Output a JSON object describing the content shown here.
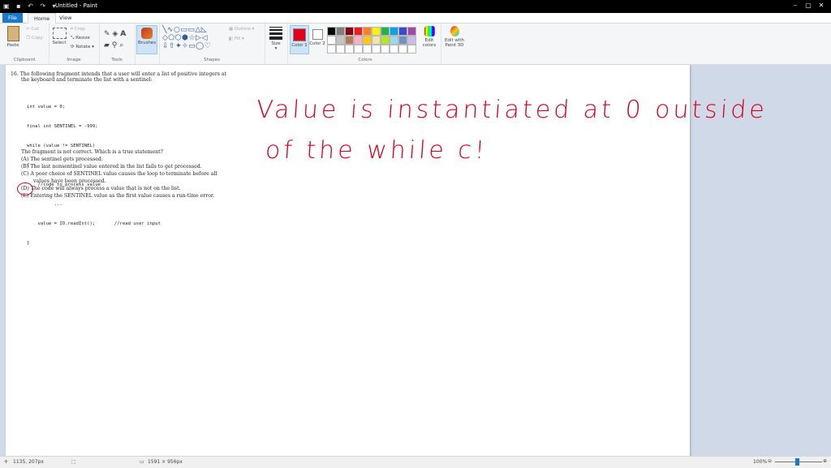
{
  "window": {
    "title": "Untitled - Paint"
  },
  "tabs": {
    "file": "File",
    "home": "Home",
    "view": "View"
  },
  "ribbon": {
    "clipboard": {
      "label": "Clipboard",
      "paste": "Paste",
      "cut": "Cut",
      "copy": "Copy"
    },
    "image": {
      "label": "Image",
      "select": "Select",
      "crop": "Crop",
      "resize": "Resize",
      "rotate": "Rotate"
    },
    "tools": {
      "label": "Tools"
    },
    "brushes": {
      "label": "Brushes"
    },
    "shapes": {
      "label": "Shapes",
      "outline": "Outline",
      "fill": "Fill"
    },
    "size": {
      "label": "Size"
    },
    "color1": {
      "label": "Color 1",
      "color": "#e0001b"
    },
    "color2": {
      "label": "Color 2",
      "color": "#ffffff"
    },
    "colors": {
      "label": "Colors",
      "edit": "Edit colors",
      "paint3d": "Edit with Paint 3D"
    },
    "palette": [
      "#000000",
      "#7f7f7f",
      "#880015",
      "#ed1c24",
      "#ff7f27",
      "#fff200",
      "#22b14c",
      "#00a2e8",
      "#3f48cc",
      "#a349a4",
      "#ffffff",
      "#c3c3c3",
      "#b97a57",
      "#ffaec9",
      "#ffc90e",
      "#efe4b0",
      "#b5e61d",
      "#99d9ea",
      "#7092be",
      "#c8bfe7",
      "#ffffff",
      "#ffffff",
      "#ffffff",
      "#ffffff",
      "#ffffff",
      "#ffffff",
      "#ffffff",
      "#ffffff",
      "#ffffff",
      "#ffffff"
    ]
  },
  "document": {
    "q_line1": "16.  The following fragment intends that a user will enter a list of positive integers at",
    "q_line2": "the keyboard and terminate the list with a sentinel:",
    "code": [
      "int value = 0;",
      "final int SENTINEL = -999;",
      "while (value != SENTINEL)",
      "{",
      "    //code to process value",
      "          ...",
      "    value = IO.readInt();       //read user input",
      "}"
    ],
    "stmt": "The fragment is not correct. Which is a true statement?",
    "a": "(A)  The sentinel gets processed.",
    "b": "(B)  The last nonsentinel value entered in the list fails to get processed.",
    "c1": "(C)  A poor choice of SENTINEL value causes the loop to terminate before all",
    "c2": "values have been processed.",
    "d": "(D)  The code will always process a value that is not on the list.",
    "e": "(E)  Entering the SENTINEL value as the first value causes a run-time error."
  },
  "handwriting": {
    "line1": "Value is instantiated at 0 outside",
    "line2": "of the while c!"
  },
  "status": {
    "cursor": "1135, 207px",
    "size": "1591 × 956px",
    "zoom": "100%"
  }
}
